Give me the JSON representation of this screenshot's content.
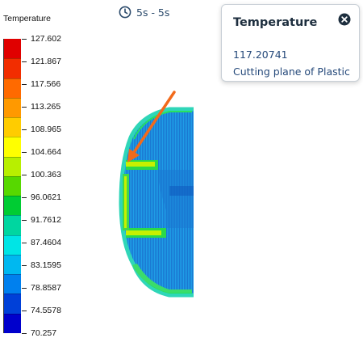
{
  "legend": {
    "title": "Temperature",
    "labels": [
      "127.602",
      "121.867",
      "117.566",
      "113.265",
      "108.965",
      "104.664",
      "100.363",
      "96.0621",
      "91.7612",
      "87.4604",
      "83.1595",
      "78.8587",
      "74.5578",
      "70.257"
    ],
    "colors": [
      "#e00000",
      "#f22d00",
      "#ff6a00",
      "#ff9900",
      "#ffcc00",
      "#ffff00",
      "#b8ef00",
      "#57d800",
      "#00cc33",
      "#00d6a0",
      "#00e5e5",
      "#00b8f0",
      "#0080ee",
      "#0040d8",
      "#0000cc"
    ]
  },
  "time": {
    "label": "5s - 5s",
    "icon": "clock-icon"
  },
  "popup": {
    "title": "Temperature",
    "value": "117.20741",
    "description": "Cutting plane of Plastic",
    "close_icon": "close-circle-icon"
  },
  "annotation": {
    "arrow_color": "#f26a1b"
  }
}
